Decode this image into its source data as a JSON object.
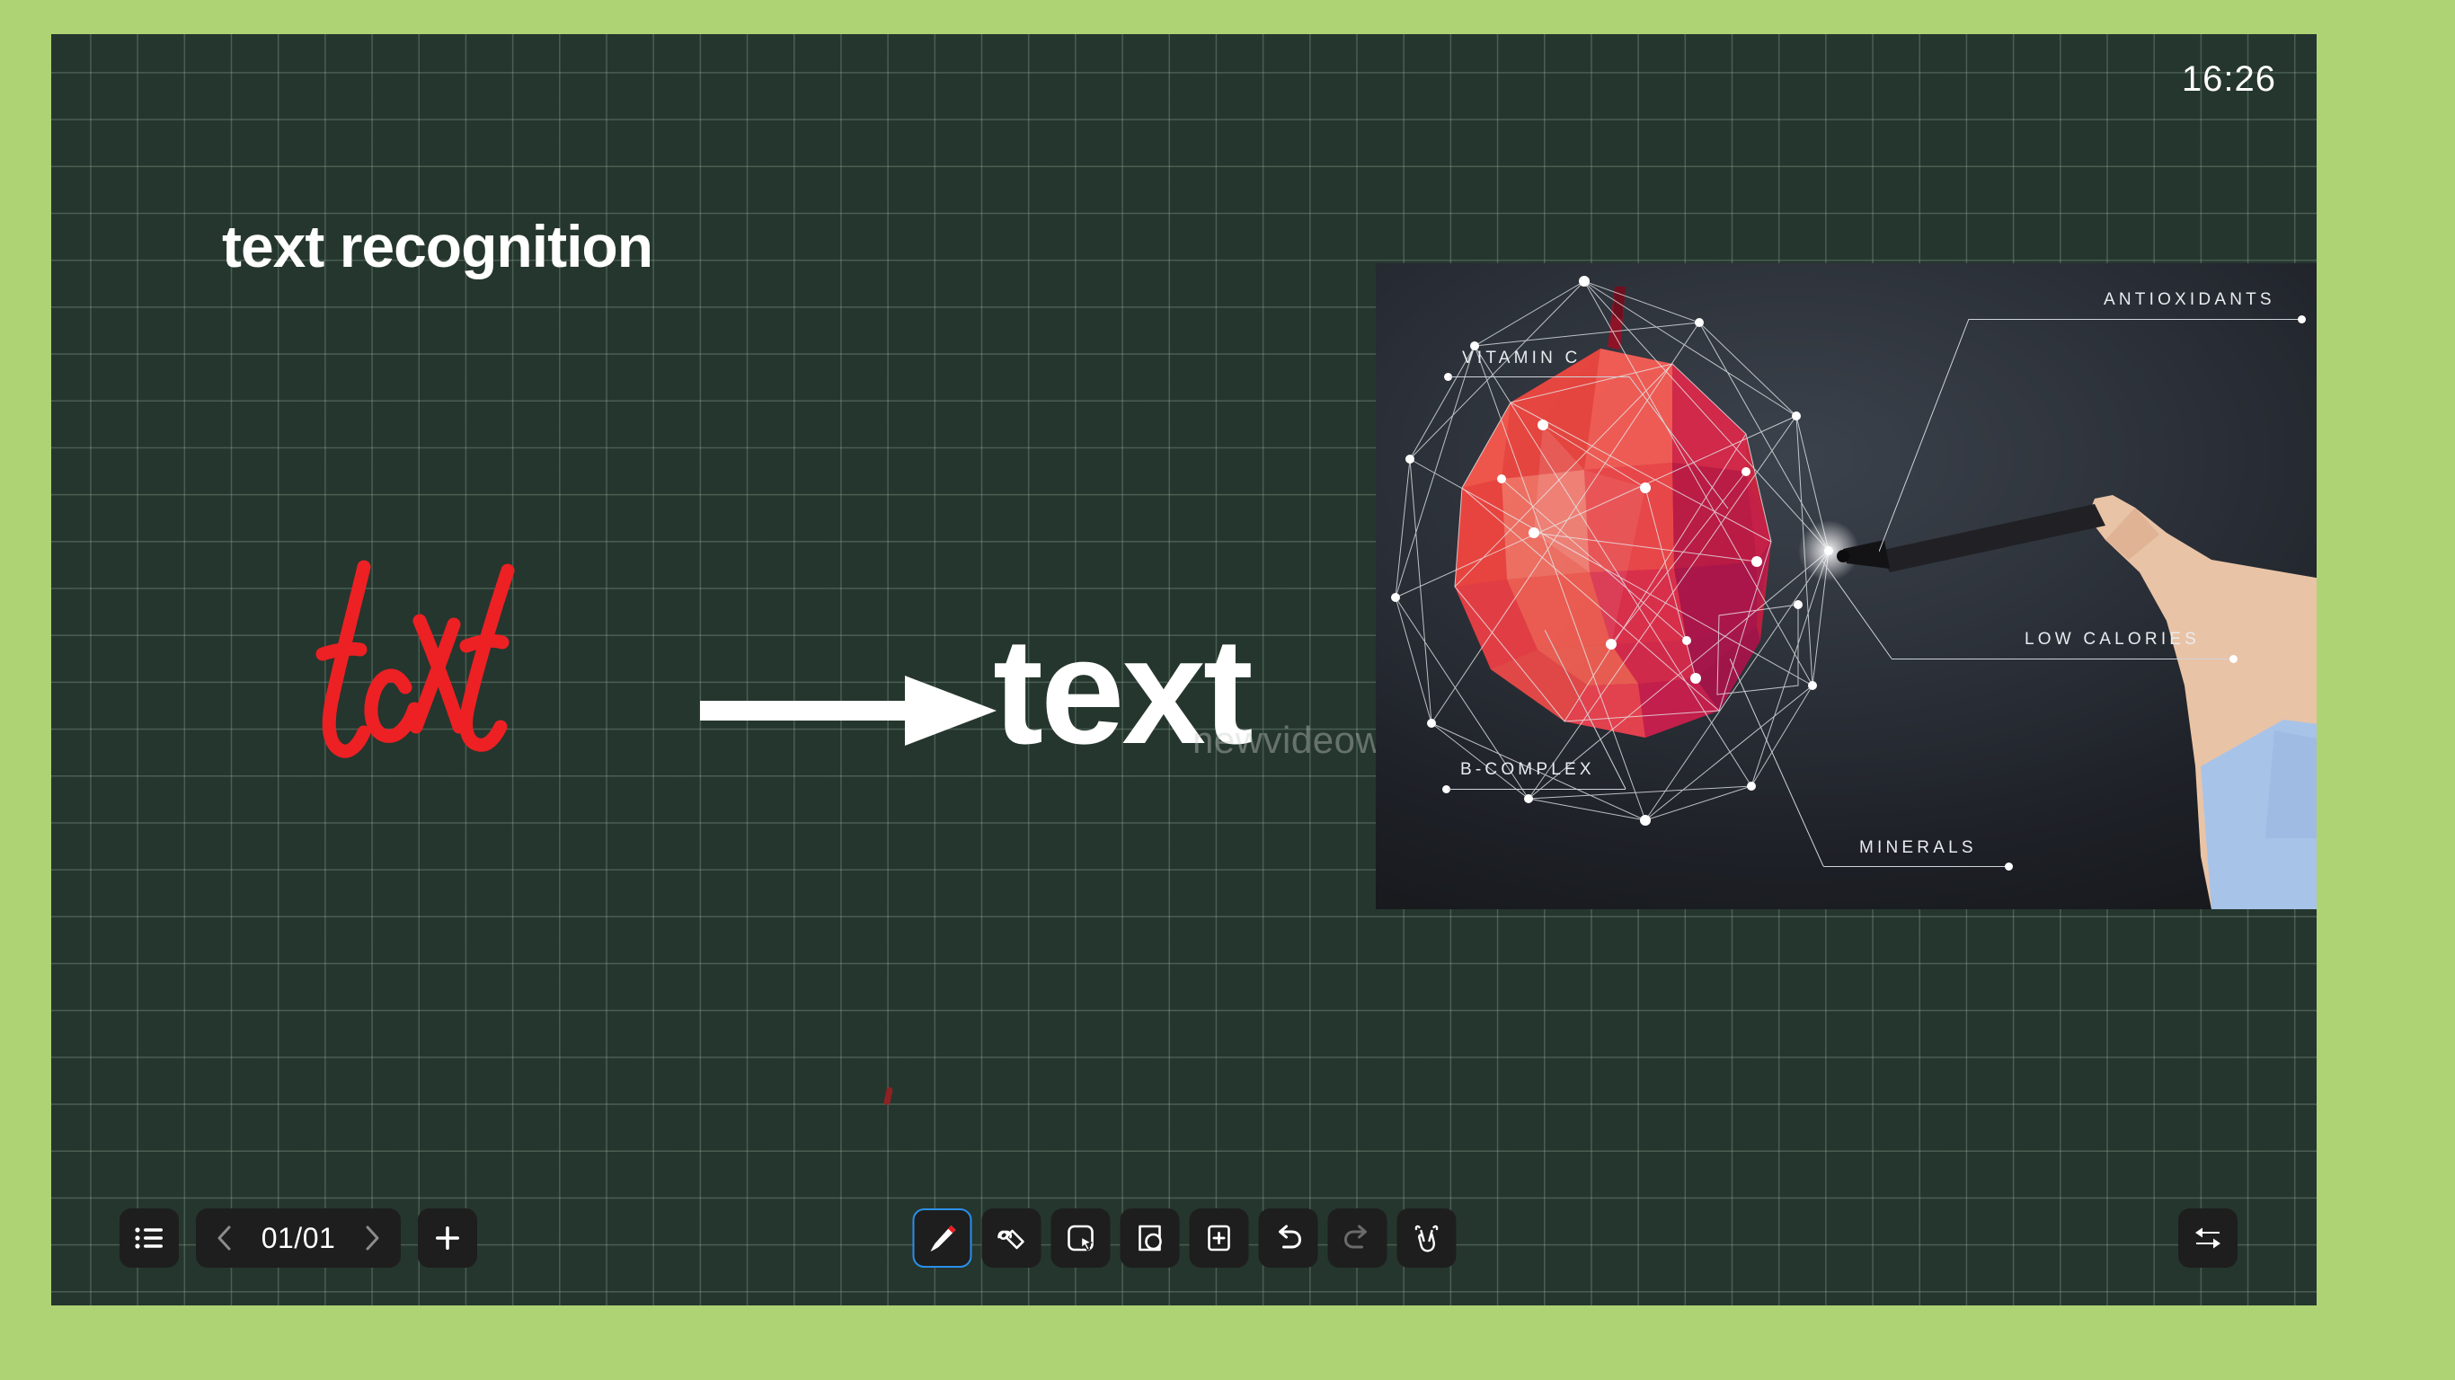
{
  "theme": {
    "bezel_color": "#aed375",
    "canvas_color": "#25362e",
    "grid_line_color": "#a0b9a5",
    "accent_selected": "#2b8fe8",
    "ink_red": "#ed2024",
    "text_white": "#ffffff"
  },
  "statusbar": {
    "clock": "16:26"
  },
  "canvas": {
    "heading": "text recognition",
    "handwriting_value": "text",
    "recognized_value": "text",
    "watermark": "newvideowall.com"
  },
  "media_panel": {
    "subject": "low-poly-apple-infographic",
    "labels": [
      {
        "text": "VITAMIN C",
        "position": "top-left"
      },
      {
        "text": "ANTIOXIDANTS",
        "position": "top-right"
      },
      {
        "text": "B-COMPLEX",
        "position": "bottom-left"
      },
      {
        "text": "LOW CALORIES",
        "position": "mid-right"
      },
      {
        "text": "MINERALS",
        "position": "bottom-center"
      }
    ]
  },
  "toolbar_left": {
    "menu_label": "list-menu",
    "prev_label": "‹",
    "page_indicator": "01/01",
    "next_label": "›",
    "add_page_label": "+"
  },
  "toolbar_center": {
    "tools": [
      {
        "name": "pen",
        "label": "Pen",
        "selected": true
      },
      {
        "name": "eraser",
        "label": "Eraser",
        "selected": false
      },
      {
        "name": "select",
        "label": "Select",
        "selected": false
      },
      {
        "name": "shape",
        "label": "Shape",
        "selected": false
      },
      {
        "name": "insert",
        "label": "Insert",
        "selected": false
      },
      {
        "name": "undo",
        "label": "Undo",
        "selected": false
      },
      {
        "name": "redo",
        "label": "Redo",
        "selected": false
      },
      {
        "name": "gesture",
        "label": "Gesture",
        "selected": false
      }
    ]
  },
  "toolbar_right": {
    "swap_label": "Switch source"
  }
}
